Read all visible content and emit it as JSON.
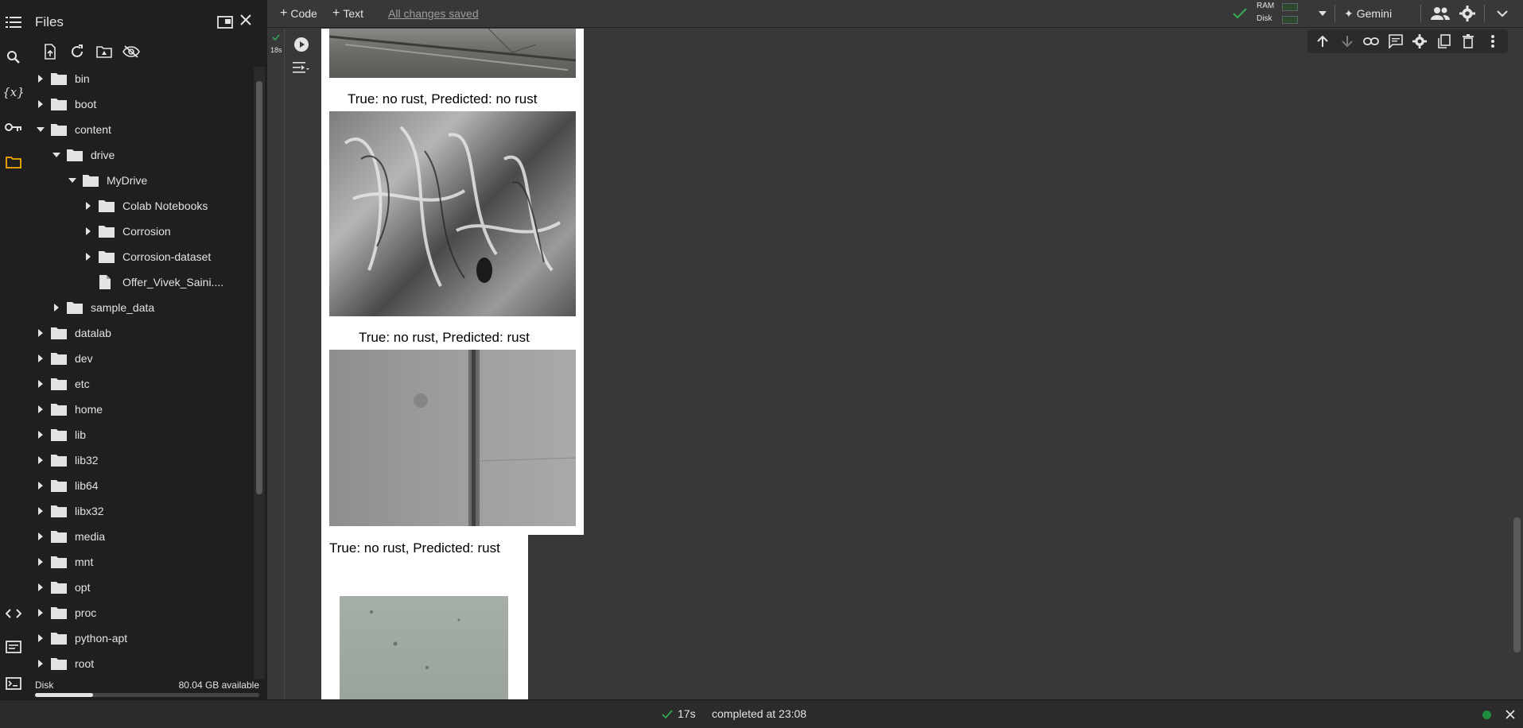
{
  "sidebar_panel": {
    "title": "Files",
    "tree": [
      {
        "label": "bin",
        "type": "folder",
        "depth": 0,
        "expanded": false
      },
      {
        "label": "boot",
        "type": "folder",
        "depth": 0,
        "expanded": false
      },
      {
        "label": "content",
        "type": "folder",
        "depth": 0,
        "expanded": true
      },
      {
        "label": "drive",
        "type": "folder",
        "depth": 1,
        "expanded": true
      },
      {
        "label": "MyDrive",
        "type": "folder",
        "depth": 2,
        "expanded": true
      },
      {
        "label": "Colab Notebooks",
        "type": "folder",
        "depth": 3,
        "expanded": false
      },
      {
        "label": "Corrosion",
        "type": "folder",
        "depth": 3,
        "expanded": false
      },
      {
        "label": "Corrosion-dataset",
        "type": "folder",
        "depth": 3,
        "expanded": false
      },
      {
        "label": "Offer_Vivek_Saini....",
        "type": "file",
        "depth": 3,
        "expanded": false
      },
      {
        "label": "sample_data",
        "type": "folder",
        "depth": 1,
        "expanded": false
      },
      {
        "label": "datalab",
        "type": "folder",
        "depth": 0,
        "expanded": false
      },
      {
        "label": "dev",
        "type": "folder",
        "depth": 0,
        "expanded": false
      },
      {
        "label": "etc",
        "type": "folder",
        "depth": 0,
        "expanded": false
      },
      {
        "label": "home",
        "type": "folder",
        "depth": 0,
        "expanded": false
      },
      {
        "label": "lib",
        "type": "folder",
        "depth": 0,
        "expanded": false
      },
      {
        "label": "lib32",
        "type": "folder",
        "depth": 0,
        "expanded": false
      },
      {
        "label": "lib64",
        "type": "folder",
        "depth": 0,
        "expanded": false
      },
      {
        "label": "libx32",
        "type": "folder",
        "depth": 0,
        "expanded": false
      },
      {
        "label": "media",
        "type": "folder",
        "depth": 0,
        "expanded": false
      },
      {
        "label": "mnt",
        "type": "folder",
        "depth": 0,
        "expanded": false
      },
      {
        "label": "opt",
        "type": "folder",
        "depth": 0,
        "expanded": false
      },
      {
        "label": "proc",
        "type": "folder",
        "depth": 0,
        "expanded": false
      },
      {
        "label": "python-apt",
        "type": "folder",
        "depth": 0,
        "expanded": false
      },
      {
        "label": "root",
        "type": "folder",
        "depth": 0,
        "expanded": false
      }
    ],
    "disk_label": "Disk",
    "disk_available": "80.04 GB available",
    "disk_used_fraction": 0.26
  },
  "toolbar": {
    "code_label": "Code",
    "text_label": "Text",
    "saved_label": "All changes saved",
    "ram_label": "RAM",
    "disk_label": "Disk",
    "gemini_label": "Gemini"
  },
  "cell": {
    "exec_time": "18s"
  },
  "output": {
    "captions": [
      "True: no rust, Predicted: no rust",
      "True: no rust, Predicted: rust",
      "True: no rust, Predicted: rust"
    ]
  },
  "status": {
    "duration": "17s",
    "message": "completed at 23:08",
    "connected_color": "#1e8e3e"
  },
  "colors": {
    "accent_orange": "#f9ab00",
    "check_green": "#34a853",
    "background": "#383838",
    "panel": "#1f1f1f"
  }
}
